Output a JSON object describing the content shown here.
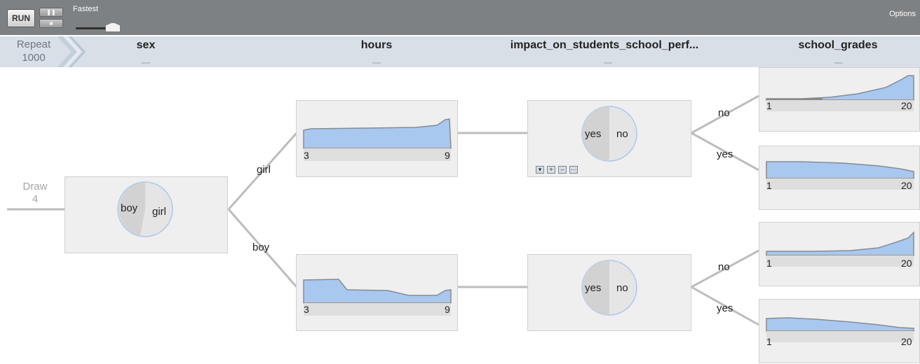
{
  "toolbar": {
    "run_label": "RUN",
    "pause_icon": "pause-icon",
    "stop_icon": "stop-icon",
    "speed_label": "Fastest",
    "options_label": "Options"
  },
  "header": {
    "repeat_label": "Repeat",
    "repeat_count": "1000",
    "columns": [
      "sex",
      "hours",
      "impact_on_students_school_perf...",
      "school_grades"
    ]
  },
  "draw": {
    "label": "Draw",
    "count": "4"
  },
  "sex_node": {
    "slices": [
      "boy",
      "girl"
    ]
  },
  "branches": {
    "girl": {
      "label": "girl",
      "hours_axis": [
        "3",
        "9"
      ],
      "impact_slices": [
        "yes",
        "no"
      ],
      "impact_buttons": [
        "dropdown-icon",
        "plus-icon",
        "minus-icon",
        "more-icon"
      ],
      "grades": {
        "no": {
          "label": "no",
          "axis": [
            "1",
            "20"
          ]
        },
        "yes": {
          "label": "yes",
          "axis": [
            "1",
            "20"
          ]
        }
      }
    },
    "boy": {
      "label": "boy",
      "hours_axis": [
        "3",
        "9"
      ],
      "impact_slices": [
        "yes",
        "no"
      ],
      "grades": {
        "no": {
          "label": "no",
          "axis": [
            "1",
            "20"
          ]
        },
        "yes": {
          "label": "yes",
          "axis": [
            "1",
            "20"
          ]
        }
      }
    }
  },
  "colors": {
    "toolbar_bg": "#7d8184",
    "header_bg": "#d8dfe7",
    "node_bg": "#efefef",
    "density_fill": "#a9c8ef",
    "density_stroke": "#8a8a8a",
    "pie_dark": "#d2d2d2",
    "pie_light": "#e5e5e5",
    "edge": "#bdbdbd"
  }
}
